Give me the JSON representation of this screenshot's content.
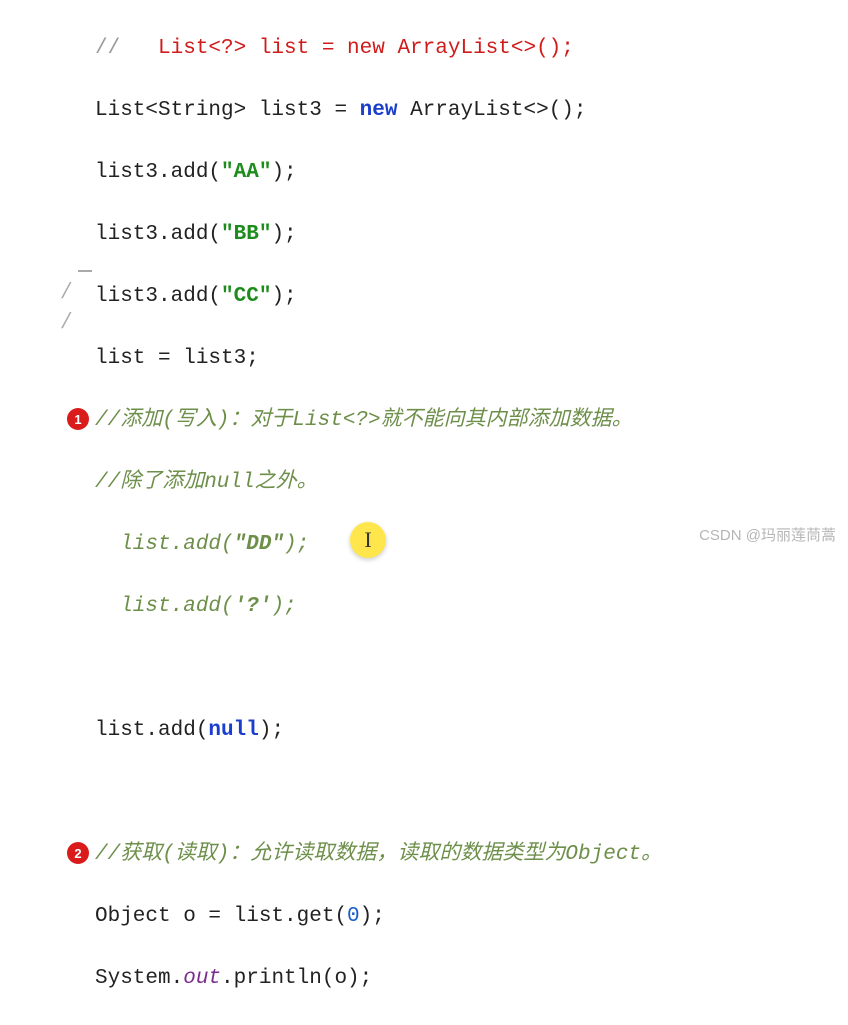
{
  "code": {
    "l1_prefix": "//   ",
    "l1_red": "List<?> list = new ArrayList<>();",
    "l2_a": "List<String> list3 = ",
    "l2_new": "new",
    "l2_b": " ArrayList<>();",
    "l3_a": "list3.add(",
    "l3_s": "\"AA\"",
    "l3_b": ");",
    "l4_a": "list3.add(",
    "l4_s": "\"BB\"",
    "l4_b": ");",
    "l5_a": "list3.add(",
    "l5_s": "\"CC\"",
    "l5_b": ");",
    "l6": "list = list3;",
    "l7": "//添加(写入)：对于List<?>就不能向其内部添加数据。",
    "l8": "//除了添加null之外。",
    "l9_a": "  list.add(",
    "l9_s": "\"DD\"",
    "l9_b": ");",
    "l10_a": "  list.add(",
    "l10_s": "'?'",
    "l10_b": ");",
    "l12_a": "list.add(",
    "l12_null": "null",
    "l12_b": ");",
    "l14": "//获取(读取)：允许读取数据，读取的数据类型为Object。",
    "l15_a": "Object o = list.get(",
    "l15_n": "0",
    "l15_b": ");",
    "l16_a": "System.",
    "l16_out": "out",
    "l16_b": ".println(o);"
  },
  "badges": {
    "b1": "1",
    "b2": "2"
  },
  "watermark": "CSDN @玛丽莲茼蒿",
  "cursor_glyph": "I"
}
